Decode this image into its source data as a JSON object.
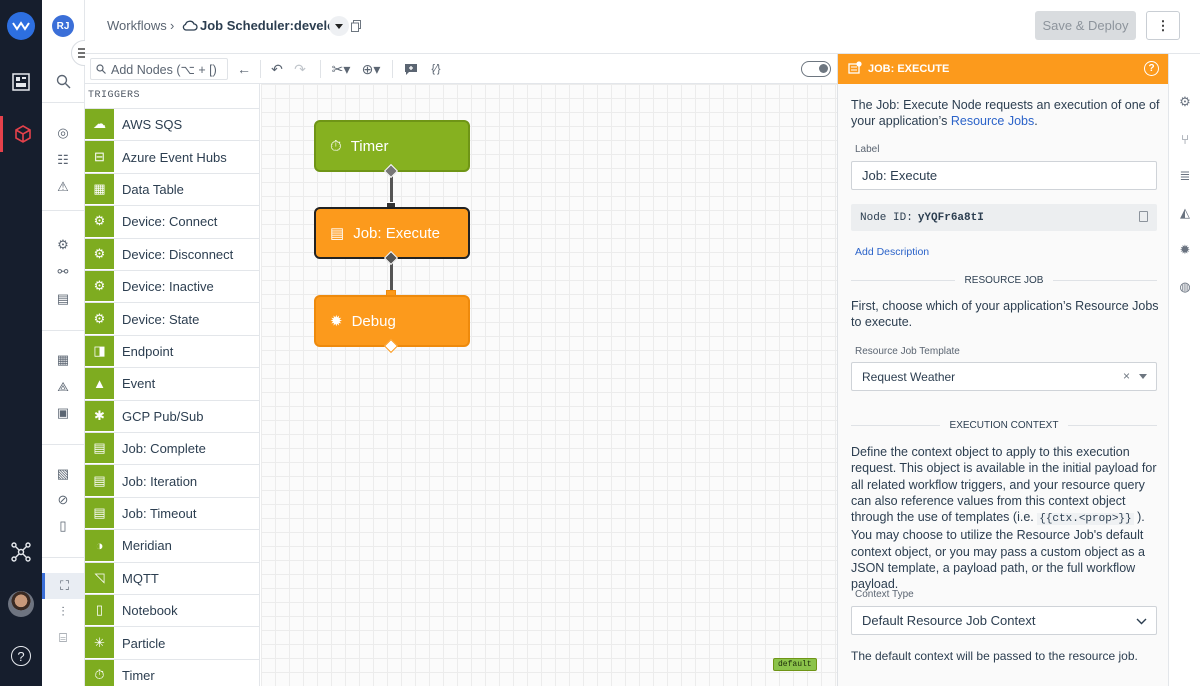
{
  "app": {
    "avatar_initials": "RJ",
    "help_glyph": "?"
  },
  "header": {
    "breadcrumb_root": "Workflows",
    "breadcrumb_sep": "›",
    "workflow_name": "Job Scheduler:develop",
    "save_label": "Save & Deploy",
    "more_label": "⋮"
  },
  "toolbar": {
    "add_nodes_placeholder": "Add Nodes (⌥ + [)"
  },
  "palette": {
    "header": "TRIGGERS",
    "items": [
      {
        "label": "AWS SQS",
        "icon": "sqs-icon",
        "glyph": "☁"
      },
      {
        "label": "Azure Event Hubs",
        "icon": "event-hubs-icon",
        "glyph": "⊟"
      },
      {
        "label": "Data Table",
        "icon": "table-icon",
        "glyph": "▦"
      },
      {
        "label": "Device: Connect",
        "icon": "device-connect-icon",
        "glyph": "⚙"
      },
      {
        "label": "Device: Disconnect",
        "icon": "device-disconnect-icon",
        "glyph": "⚙"
      },
      {
        "label": "Device: Inactive",
        "icon": "device-inactive-icon",
        "glyph": "⚙"
      },
      {
        "label": "Device: State",
        "icon": "device-state-icon",
        "glyph": "⚙"
      },
      {
        "label": "Endpoint",
        "icon": "endpoint-icon",
        "glyph": "◨"
      },
      {
        "label": "Event",
        "icon": "warning-icon",
        "glyph": "▲"
      },
      {
        "label": "GCP Pub/Sub",
        "icon": "pubsub-icon",
        "glyph": "✱"
      },
      {
        "label": "Job: Complete",
        "icon": "job-complete-icon",
        "glyph": "▤"
      },
      {
        "label": "Job: Iteration",
        "icon": "job-iteration-icon",
        "glyph": "▤"
      },
      {
        "label": "Job: Timeout",
        "icon": "job-timeout-icon",
        "glyph": "▤"
      },
      {
        "label": "Meridian",
        "icon": "meridian-icon",
        "glyph": "◑"
      },
      {
        "label": "MQTT",
        "icon": "mqtt-icon",
        "glyph": "◹"
      },
      {
        "label": "Notebook",
        "icon": "notebook-icon",
        "glyph": "▯"
      },
      {
        "label": "Particle",
        "icon": "particle-icon",
        "glyph": "✳"
      },
      {
        "label": "Timer",
        "icon": "timer-icon",
        "glyph": "⏱"
      }
    ]
  },
  "canvas": {
    "nodes": [
      {
        "label": "Timer",
        "icon": "timer-icon",
        "glyph": "⏱"
      },
      {
        "label": "Job: Execute",
        "icon": "job-execute-icon",
        "glyph": "▤"
      },
      {
        "label": "Debug",
        "icon": "bug-icon",
        "glyph": "✹"
      }
    ],
    "version_badge": "default"
  },
  "panel": {
    "title": "JOB: EXECUTE",
    "intro_before": "The Job: Execute Node requests an execution of one of your application’s ",
    "intro_link": "Resource Jobs",
    "intro_after": ".",
    "label_caption": "Label",
    "label_value": "Job: Execute",
    "node_id_caption": "Node ID:",
    "node_id_value": "yYQFr6a8tI",
    "add_description": "Add Description",
    "resource_section": "RESOURCE JOB",
    "resource_help": "First, choose which of your application’s Resource Jobs to execute.",
    "template_caption": "Resource Job Template",
    "template_value": "Request Weather",
    "context_section": "EXECUTION CONTEXT",
    "context_help_before": "Define the context object to apply to this execution request. This object is available in the initial payload for all related workflow triggers, and your resource query can also reference values from this context object through the use of templates (i.e. ",
    "context_help_code": "{{ctx.<prop>}}",
    "context_help_after": " ). You may choose to utilize the Resource Job's default context object, or you may pass a custom object as a JSON template, a payload path, or the full workflow payload.",
    "context_type_caption": "Context Type",
    "context_type_value": "Default Resource Job Context",
    "context_footer": "The default context will be passed to the resource job."
  },
  "colors": {
    "trigger_green": "#7eac20",
    "node_orange": "#fc9a1c",
    "rail_dark": "#161e2d",
    "link_blue": "#2b63c9"
  }
}
